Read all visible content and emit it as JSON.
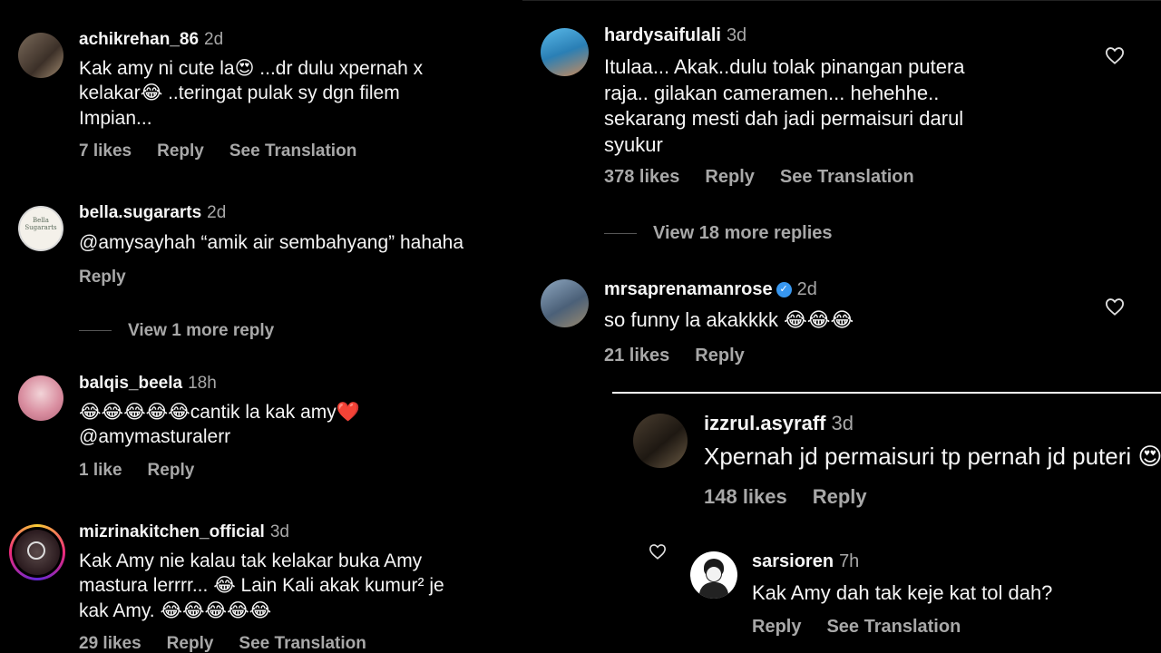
{
  "left_panel": {
    "comments": [
      {
        "username": "achikrehan_86",
        "time": "2d",
        "text_lines": [
          "Kak amy ni cute la😍 ...dr dulu xpernah x",
          "kelakar😂 ..teringat pulak sy dgn filem",
          "Impian..."
        ],
        "likes": "7 likes",
        "reply": "Reply",
        "translate": "See Translation"
      },
      {
        "username": "bella.sugararts",
        "time": "2d",
        "text_lines": [
          "@amysayhah “amik air sembahyang” hahaha"
        ],
        "reply": "Reply",
        "view_more": "View 1 more reply",
        "avatar_text": [
          "Bella",
          "Sugararts"
        ]
      },
      {
        "username": "balqis_beela",
        "time": "18h",
        "text_lines": [
          "😂😂😂😂😂cantik la kak amy❤️",
          "@amymasturalerr"
        ],
        "likes": "1 like",
        "reply": "Reply"
      },
      {
        "username": "mizrinakitchen_official",
        "time": "3d",
        "text_lines": [
          "Kak Amy nie kalau tak kelakar buka Amy",
          "mastura lerrrr... 😂 Lain Kali akak kumur² je",
          "kak Amy. 😂😂😂😂😂"
        ],
        "likes": "29 likes",
        "reply": "Reply",
        "translate": "See Translation"
      }
    ]
  },
  "right_top_panel": {
    "comments": [
      {
        "username": "hardysaifulali",
        "time": "3d",
        "text_lines": [
          "Itulaa... Akak..dulu tolak pinangan putera",
          "raja.. gilakan cameramen... hehehhe..",
          "sekarang mesti dah jadi permaisuri darul",
          "syukur"
        ],
        "likes": "378 likes",
        "reply": "Reply",
        "translate": "See Translation",
        "view_more": "View 18 more replies"
      },
      {
        "username": "mrsaprenamanrose",
        "time": "2d",
        "verified": true,
        "text_lines": [
          "so funny la akakkkk 😂😂😂"
        ],
        "likes": "21 likes",
        "reply": "Reply"
      }
    ]
  },
  "right_bottom_panel": {
    "comments": [
      {
        "username": "izzrul.asyraff",
        "time": "3d",
        "text_lines": [
          "Xpernah jd permaisuri tp pernah jd puteri 😍"
        ],
        "likes": "148 likes",
        "reply": "Reply"
      },
      {
        "username": "sarsioren",
        "time": "7h",
        "text_lines": [
          "Kak Amy dah tak keje kat tol dah?"
        ],
        "reply": "Reply",
        "translate": "See Translation"
      }
    ]
  },
  "colors": {
    "background": "#000000",
    "text": "#f5f5f5",
    "muted": "#a8a8a8",
    "verified": "#3797f0"
  },
  "icons": [
    "heart-icon",
    "verified-badge-icon"
  ]
}
